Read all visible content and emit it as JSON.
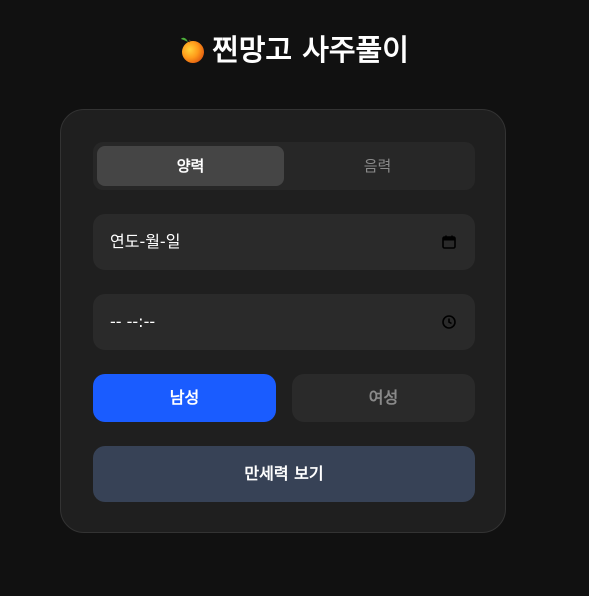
{
  "header": {
    "icon": "mango-icon",
    "title": "찐망고 사주풀이"
  },
  "calendar_toggle": {
    "options": [
      "양력",
      "음력"
    ],
    "selected": "양력"
  },
  "birth_date": {
    "value": "연도-월-일",
    "icon": "calendar-icon"
  },
  "birth_time": {
    "value": "-- --:--",
    "icon": "clock-icon"
  },
  "gender": {
    "options": [
      "남성",
      "여성"
    ],
    "selected": "남성"
  },
  "submit_label": "만세력 보기",
  "colors": {
    "background": "#111111",
    "card": "#1f1f1f",
    "accent": "#1a5cff",
    "submit": "#374256"
  }
}
